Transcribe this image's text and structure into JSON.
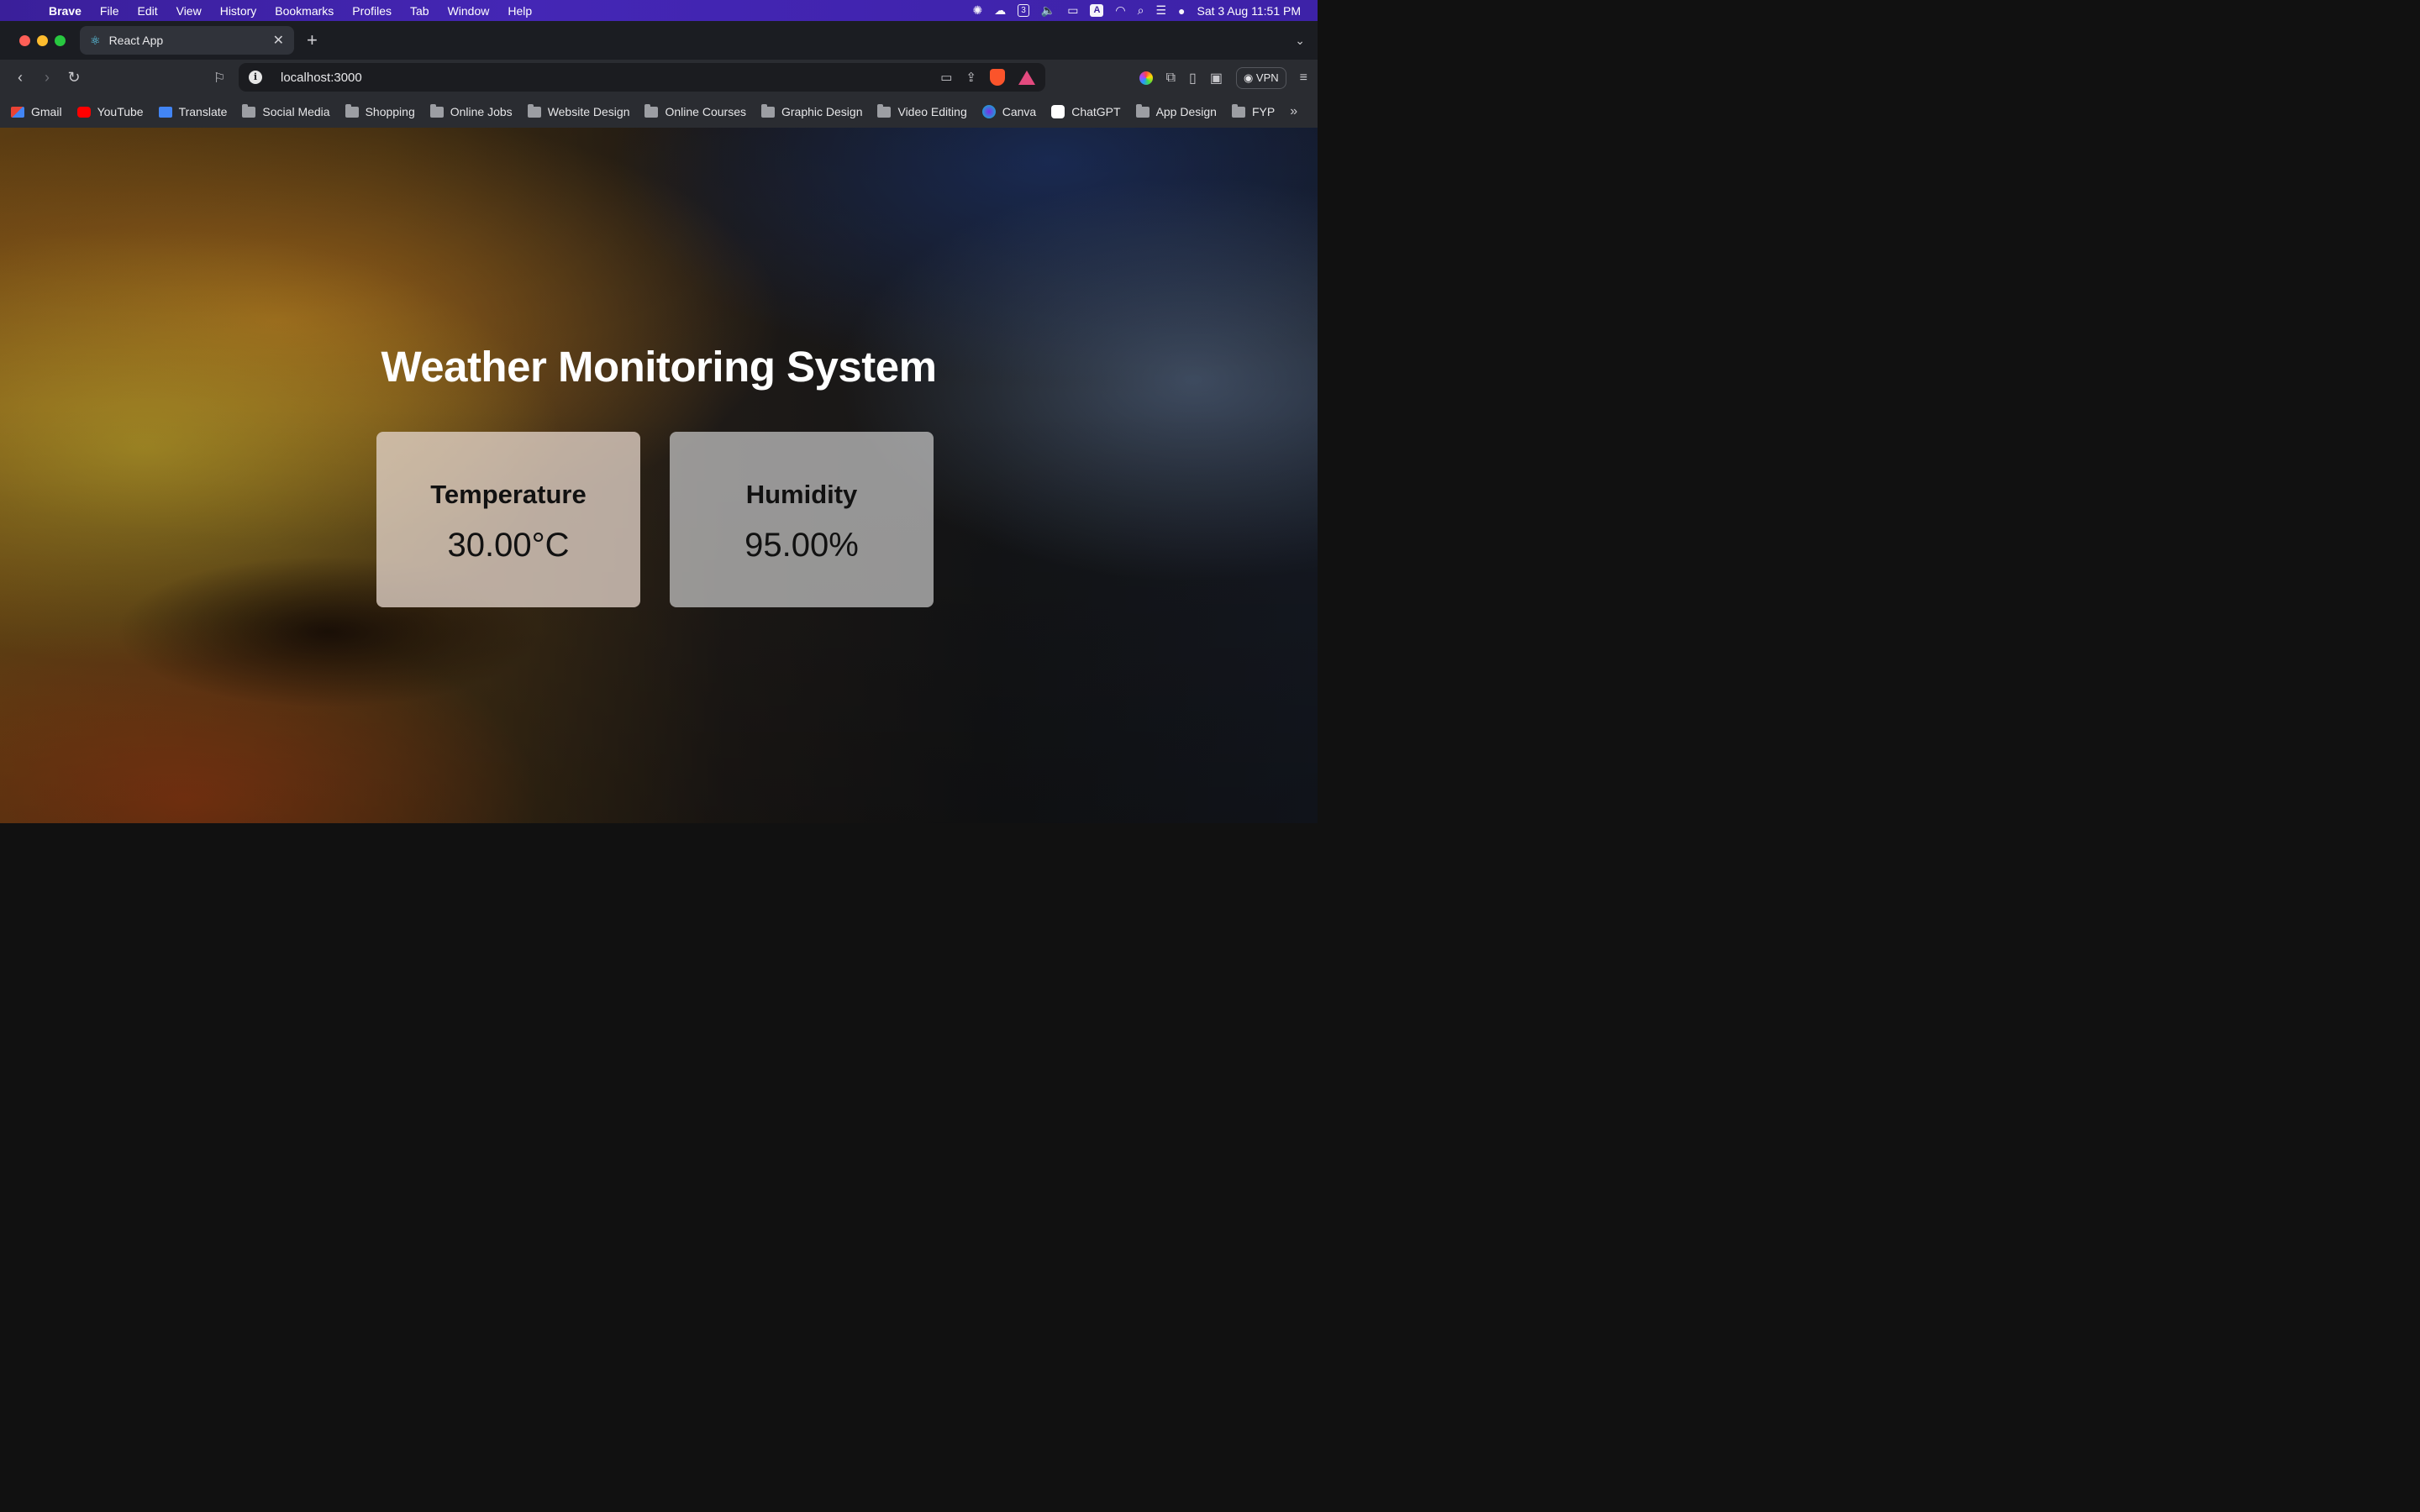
{
  "menubar": {
    "app_name": "Brave",
    "items": [
      "File",
      "Edit",
      "View",
      "History",
      "Bookmarks",
      "Profiles",
      "Tab",
      "Window",
      "Help"
    ],
    "status_icons": [
      "chatgpt-icon",
      "creative-cloud-icon",
      "calendar-icon",
      "volume-icon",
      "battery-icon",
      "input-source-icon",
      "wifi-icon",
      "search-icon",
      "control-center-icon",
      "siri-icon"
    ],
    "calendar_badge": "3",
    "input_source": "A",
    "datetime": "Sat 3 Aug  11:51 PM"
  },
  "browser": {
    "tab": {
      "title": "React App"
    },
    "url": "localhost:3000",
    "vpn_label": "VPN"
  },
  "bookmarks": [
    {
      "label": "Gmail",
      "icon": "gmail"
    },
    {
      "label": "YouTube",
      "icon": "yt"
    },
    {
      "label": "Translate",
      "icon": "translate"
    },
    {
      "label": "Social Media",
      "icon": "folder"
    },
    {
      "label": "Shopping",
      "icon": "folder"
    },
    {
      "label": "Online Jobs",
      "icon": "folder"
    },
    {
      "label": "Website Design",
      "icon": "folder"
    },
    {
      "label": "Online Courses",
      "icon": "folder"
    },
    {
      "label": "Graphic Design",
      "icon": "folder"
    },
    {
      "label": "Video Editing",
      "icon": "folder"
    },
    {
      "label": "Canva",
      "icon": "canva"
    },
    {
      "label": "ChatGPT",
      "icon": "chatgpt"
    },
    {
      "label": "App Design",
      "icon": "folder"
    },
    {
      "label": "FYP",
      "icon": "folder"
    }
  ],
  "page": {
    "title": "Weather Monitoring System",
    "cards": {
      "temperature": {
        "label": "Temperature",
        "value": "30.00°C"
      },
      "humidity": {
        "label": "Humidity",
        "value": "95.00%"
      }
    }
  }
}
